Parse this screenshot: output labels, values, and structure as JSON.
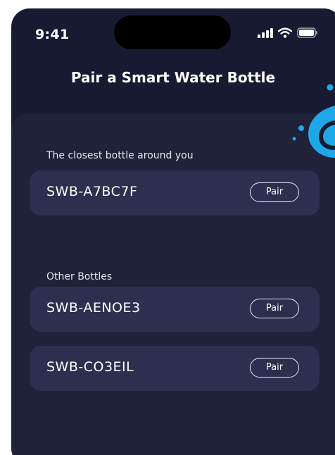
{
  "status_bar": {
    "time": "9:41",
    "icons": [
      "signal-icon",
      "wifi-icon",
      "battery-icon"
    ]
  },
  "title": "Pair a Smart Water Bottle",
  "sections": {
    "closest": {
      "label": "The closest bottle around you",
      "bottles": [
        {
          "name": "SWB-A7BC7F",
          "button": "Pair"
        }
      ]
    },
    "other": {
      "label": "Other  Bottles",
      "bottles": [
        {
          "name": "SWB-AENOE3",
          "button": "Pair"
        },
        {
          "name": "SWB-CO3EIL",
          "button": "Pair"
        }
      ]
    }
  },
  "colors": {
    "background": "#181a31",
    "sheet": "#202239",
    "row": "#2c2f4d",
    "accent": "#1fa8e8"
  }
}
